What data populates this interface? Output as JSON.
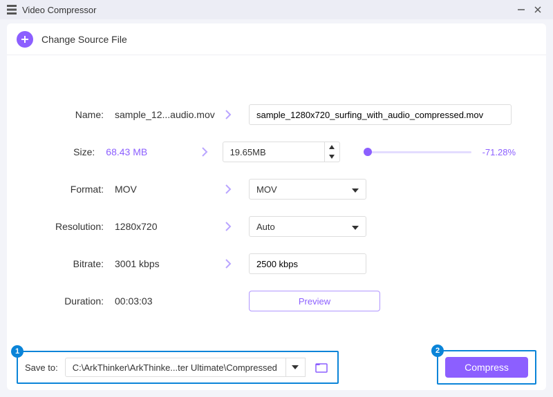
{
  "window": {
    "title": "Video Compressor"
  },
  "header": {
    "change_source": "Change Source File"
  },
  "labels": {
    "name": "Name:",
    "size": "Size:",
    "format": "Format:",
    "resolution": "Resolution:",
    "bitrate": "Bitrate:",
    "duration": "Duration:"
  },
  "values": {
    "name_display": "sample_12...audio.mov",
    "name_full": "sample_1280x720_surfing_with_audio_compressed.mov",
    "size_original": "68.43 MB",
    "size_target": "19.65MB",
    "size_reduction": "-71.28%",
    "format_original": "MOV",
    "format_target": "MOV",
    "resolution_original": "1280x720",
    "resolution_target": "Auto",
    "bitrate_original": "3001 kbps",
    "bitrate_target": "2500 kbps",
    "duration": "00:03:03"
  },
  "buttons": {
    "preview": "Preview",
    "compress": "Compress"
  },
  "footer": {
    "save_to_label": "Save to:",
    "save_path": "C:\\ArkThinker\\ArkThinke...ter Ultimate\\Compressed"
  },
  "steps": {
    "one": "1",
    "two": "2"
  },
  "colors": {
    "accent": "#8c5fff",
    "highlight": "#0a84d8"
  }
}
